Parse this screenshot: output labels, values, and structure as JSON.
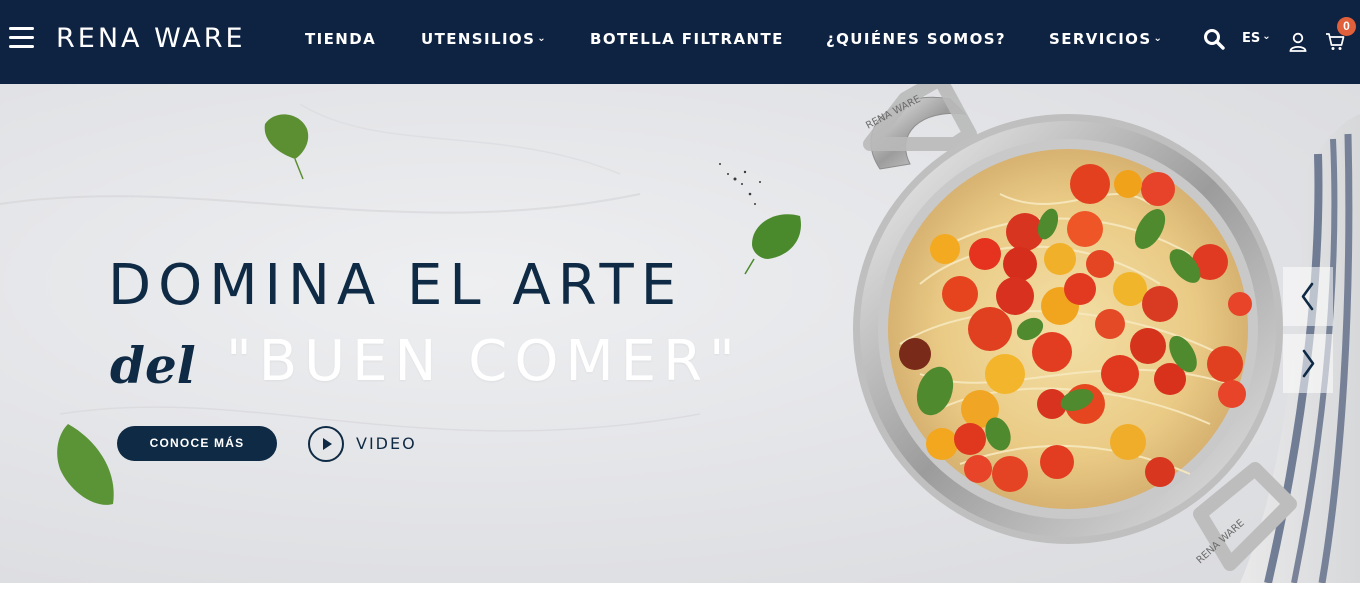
{
  "header": {
    "brand": "RENA WARE",
    "nav": [
      {
        "label": "TIENDA",
        "dropdown": false
      },
      {
        "label": "UTENSILIOS",
        "dropdown": true
      },
      {
        "label": "BOTELLA FILTRANTE",
        "dropdown": false
      },
      {
        "label": "¿QUIÉNES SOMOS?",
        "dropdown": false
      },
      {
        "label": "SERVICIOS",
        "dropdown": true
      }
    ],
    "language": "ES",
    "cart_count": "0",
    "icons": [
      "menu-icon",
      "search-icon",
      "user-icon",
      "cart-icon"
    ]
  },
  "hero": {
    "headline_line1": "DOMINA EL ARTE",
    "headline_script": "del",
    "headline_line2": "\"BUEN COMER\"",
    "cta_label": "CONOCE MÁS",
    "video_label": "VIDEO",
    "pan_brand": "RENA WARE",
    "icons": [
      "play-icon",
      "chevron-left-icon",
      "chevron-right-icon"
    ]
  },
  "colors": {
    "header_bg": "#0e2242",
    "navy": "#0f2a44",
    "badge": "#e0603b",
    "hero_bg": "#e4e5e8"
  }
}
